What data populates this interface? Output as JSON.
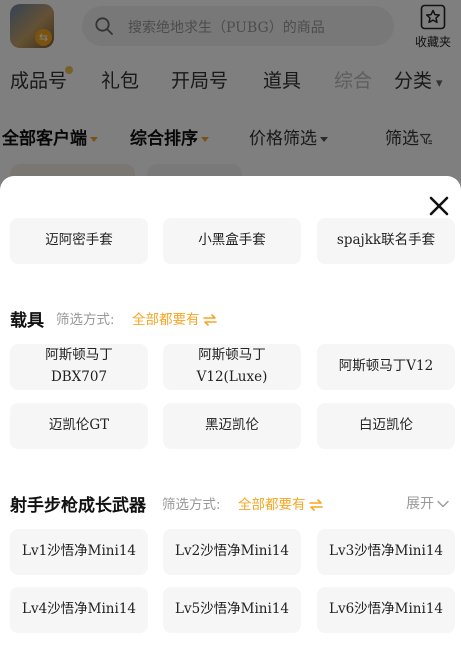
{
  "header": {
    "search_placeholder": "搜索绝地求生（PUBG）的商品",
    "favorites_label": "收藏夹"
  },
  "category_tabs": [
    {
      "label": "成品号"
    },
    {
      "label": "礼包"
    },
    {
      "label": "开局号"
    },
    {
      "label": "道具"
    },
    {
      "label": "综合"
    },
    {
      "label": "分类"
    }
  ],
  "filters": [
    {
      "label": "全部客户端"
    },
    {
      "label": "综合排序"
    },
    {
      "label": "价格筛选"
    },
    {
      "label": "筛选"
    }
  ],
  "sheet": {
    "top_row": [
      {
        "label": "迈阿密手套"
      },
      {
        "label": "小黑盒手套"
      },
      {
        "label": "spajkk联名手套"
      }
    ],
    "vehicles": {
      "title": "载具",
      "mode_label": "筛选方式:",
      "mode_value": "全部都要有",
      "options": [
        {
          "label": "阿斯顿马丁\nDBX707"
        },
        {
          "label": "阿斯顿马丁\nV12(Luxe)"
        },
        {
          "label": "阿斯顿马丁V12"
        },
        {
          "label": "迈凯伦GT"
        },
        {
          "label": "黑迈凯伦"
        },
        {
          "label": "白迈凯伦"
        }
      ]
    },
    "weapons": {
      "title": "射手步枪成长武器",
      "mode_label": "筛选方式:",
      "mode_value": "全部都要有",
      "expand_label": "展开",
      "options": [
        {
          "label": "Lv1沙悟净Mini14"
        },
        {
          "label": "Lv2沙悟净Mini14"
        },
        {
          "label": "Lv3沙悟净Mini14"
        },
        {
          "label": "Lv4沙悟净Mini14"
        },
        {
          "label": "Lv5沙悟净Mini14"
        },
        {
          "label": "Lv6沙悟净Mini14"
        }
      ]
    }
  },
  "colors": {
    "accent": "#f5a623",
    "overlay": "rgba(0,0,0,0.5)",
    "chip_bg": "#f6f6f6"
  },
  "icons": [
    "search-icon",
    "star-icon",
    "close-icon",
    "swap-icon",
    "chevron-down-icon",
    "funnel-icon"
  ]
}
